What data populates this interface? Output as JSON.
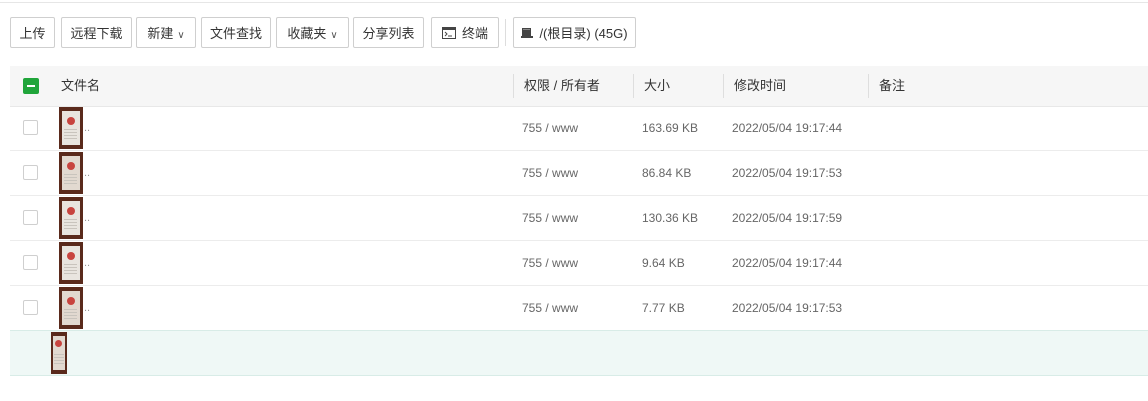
{
  "toolbar": {
    "upload": "上传",
    "remote_download": "远程下载",
    "new": "新建",
    "file_search": "文件查找",
    "favorites": "收藏夹",
    "share_list": "分享列表",
    "terminal": "终端",
    "disk": "/(根目录) (45G)"
  },
  "table": {
    "headers": {
      "name": "文件名",
      "permission": "权限 / 所有者",
      "size": "大小",
      "mtime": "修改时间",
      "note": "备注"
    },
    "rows": [
      {
        "name": "..",
        "permission": "755 / www",
        "size": "163.69 KB",
        "mtime": "2022/05/04 19:17:44"
      },
      {
        "name": "..",
        "permission": "755 / www",
        "size": "86.84 KB",
        "mtime": "2022/05/04 19:17:53"
      },
      {
        "name": "..",
        "permission": "755 / www",
        "size": "130.36 KB",
        "mtime": "2022/05/04 19:17:59"
      },
      {
        "name": "..",
        "permission": "755 / www",
        "size": "9.64 KB",
        "mtime": "2022/05/04 19:17:44"
      },
      {
        "name": "..",
        "permission": "755 / www",
        "size": "7.77 KB",
        "mtime": "2022/05/04 19:17:53"
      }
    ]
  },
  "colors": {
    "accent_green": "#20a53a",
    "selected_row_bg": "#eff8f6",
    "header_bg": "#f6f6f6"
  },
  "icons": {
    "terminal": "terminal-icon",
    "disk": "disk-icon",
    "dropdown": "chevron-down-icon"
  }
}
